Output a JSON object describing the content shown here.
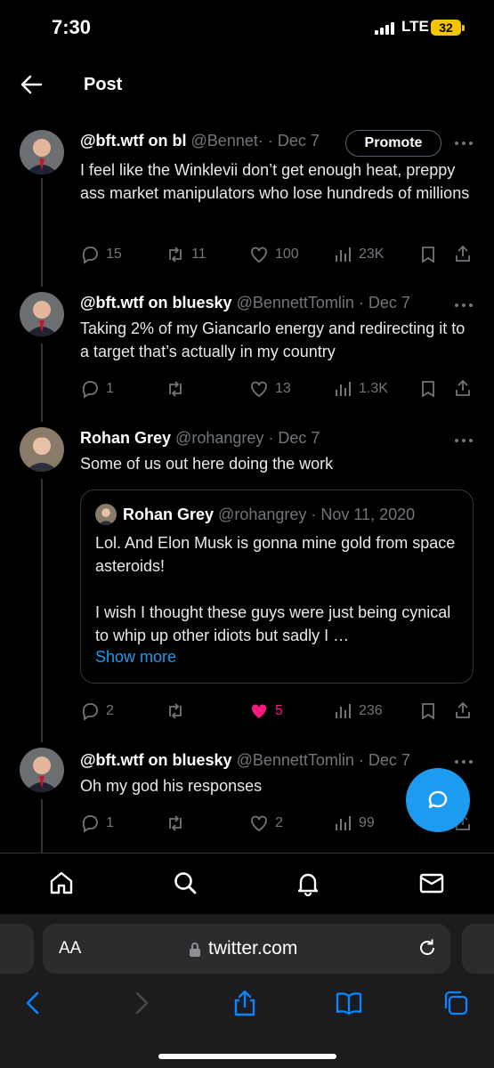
{
  "status_bar": {
    "time": "7:30",
    "network": "LTE",
    "battery": "32"
  },
  "header": {
    "title": "Post"
  },
  "tweets": [
    {
      "name": "@bft.wtf on bl",
      "meta": "@Bennet· · Dec 7",
      "promote": "Promote",
      "text": "I feel like the Winklevii don’t get enough heat, preppy ass market manipulators who lose hundreds of millions",
      "replies": "15",
      "retweets": "11",
      "likes": "100",
      "views": "23K"
    },
    {
      "name": "@bft.wtf on bluesky",
      "meta": "@BennettTomlin · Dec 7",
      "text": "Taking 2% of my Giancarlo energy and redirecting it to a target that’s actually in my country",
      "replies": "1",
      "retweets": "",
      "likes": "13",
      "views": "1.3K"
    },
    {
      "name": "Rohan Grey",
      "meta": "@rohangrey · Dec 7",
      "text": "Some of us out here doing the work",
      "quote": {
        "name": "Rohan Grey",
        "meta": "@rohangrey · Nov 11, 2020",
        "text": "Lol. And Elon Musk is gonna mine gold from space asteroids!\n\nI wish I thought these guys were just being cynical to whip up other idiots but sadly I …",
        "show_more": "Show more"
      },
      "replies": "2",
      "retweets": "",
      "likes": "5",
      "views": "236"
    },
    {
      "name": "@bft.wtf on bluesky",
      "meta": "@BennettTomlin · Dec 7",
      "text": "Oh my god his responses",
      "replies": "1",
      "retweets": "",
      "likes": "2",
      "views": "99"
    }
  ],
  "safari": {
    "text_size": "AA",
    "url": "twitter.com"
  },
  "colors": {
    "accent": "#1d9bf0",
    "like": "#f91880",
    "muted": "#71767b",
    "battery": "#f5c400"
  }
}
